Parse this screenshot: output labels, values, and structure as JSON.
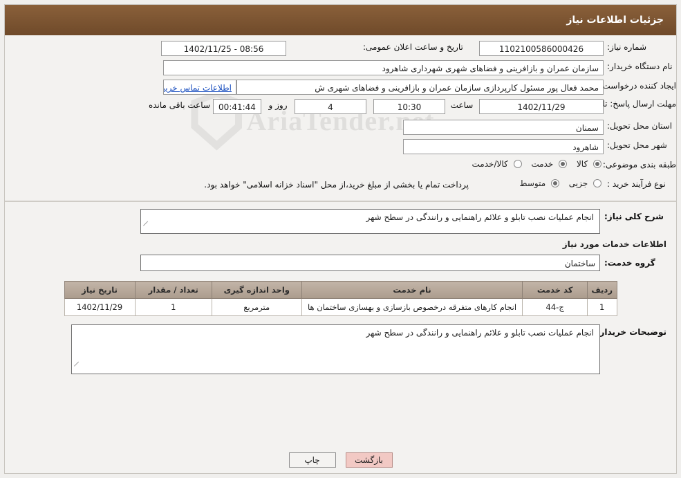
{
  "header": {
    "title": "جزئیات اطلاعات نیاز"
  },
  "top": {
    "need_number_label": "شماره نیاز:",
    "need_number_value": "1102100586000426",
    "announce_datetime_label": "تاریخ و ساعت اعلان عمومی:",
    "announce_datetime_value": "08:56 - 1402/11/25",
    "buyer_org_label": "نام دستگاه خریدار:",
    "buyer_org_value": "سازمان عمران و بازافرینی و فضاهای شهری شهرداری شاهرود",
    "requester_label": "ایجاد کننده درخواست:",
    "requester_value": "محمد فعال پور مسئول کارپردازی سازمان عمران و بازافرینی و فضاهای شهری ش",
    "contact_link": "اطلاعات تماس خریدار",
    "deadline_label": "مهلت ارسال پاسخ: تا تاریخ:",
    "deadline_date": "1402/11/29",
    "hour_label": "ساعت",
    "hour_value": "10:30",
    "days_value": "4",
    "days_unit": "روز و",
    "remaining_value": "00:41:44",
    "remaining_label": "ساعت باقی مانده",
    "province_label": "استان محل تحویل:",
    "province_value": "سمنان",
    "city_label": "شهر محل تحویل:",
    "city_value": "شاهرود",
    "category_label": "طبقه بندی موضوعی:",
    "category_options": [
      "کالا",
      "خدمت",
      "کالا/خدمت"
    ],
    "category_selected": "خدمت",
    "process_label": "نوع فرآیند خرید :",
    "process_options": [
      "جزیی",
      "متوسط"
    ],
    "process_selected": "متوسط",
    "process_note": "پرداخت تمام یا بخشی از مبلغ خرید،از محل \"اسناد خزانه اسلامی\" خواهد بود."
  },
  "middle": {
    "general_desc_label": "شرح کلی نیاز:",
    "general_desc_value": "انجام عملیات نصب تابلو و علائم راهنمایی و رانندگی در سطح شهر",
    "services_info_title": "اطلاعات خدمات مورد نیاز",
    "service_group_label": "گروه خدمت:",
    "service_group_value": "ساختمان",
    "table": {
      "headers": [
        "ردیف",
        "کد خدمت",
        "نام خدمت",
        "واحد اندازه گیری",
        "تعداد / مقدار",
        "تاریخ نیاز"
      ],
      "rows": [
        [
          "1",
          "ج-44",
          "انجام کارهای متفرقه درخصوص بازسازی و بهسازی ساختمان ها",
          "مترمربع",
          "1",
          "1402/11/29"
        ]
      ]
    },
    "buyer_notes_label": "توضیحات خریدار:",
    "buyer_notes_value": "انجام عملیات نصب تابلو و علائم راهنمایی و رانندگی در سطح شهر"
  },
  "footer": {
    "print_label": "چاپ",
    "back_label": "بازگشت"
  },
  "watermark": {
    "text": "AriaTender.net"
  }
}
